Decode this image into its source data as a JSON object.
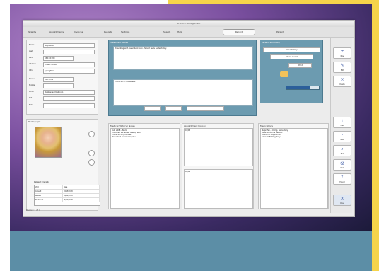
{
  "window": {
    "title": "Practice Management"
  },
  "toolbar": {
    "items": [
      "Patients",
      "Appointments",
      "Invoices",
      "Reports",
      "Settings",
      "Search",
      "Help"
    ],
    "segment_label": "Record",
    "right_label": "Patient"
  },
  "patient": {
    "fields": [
      {
        "label": "Name",
        "value": "Stephanie"
      },
      {
        "label": "Last",
        "value": ""
      },
      {
        "label": "Birth",
        "value": "03/15/1980"
      },
      {
        "label": "Address",
        "value": "4 Main Street"
      },
      {
        "label": "City",
        "value": "Springfield"
      },
      {
        "label": "Phone",
        "value": "555-1234"
      },
      {
        "label": "Mobile",
        "value": ""
      },
      {
        "label": "Email",
        "value": "stephanie@mail.com"
      },
      {
        "label": "Ref",
        "value": ""
      },
      {
        "label": "Note",
        "value": ""
      }
    ],
    "photo_label": "Photograph",
    "details_label": "Patient Details"
  },
  "notes": {
    "title": "Treatment Notes",
    "line1": "Presenting with lower back pain. Patient feels better today.",
    "line2": "Follow up in two weeks."
  },
  "history": {
    "title": "Medical History / Notes",
    "lines": [
      "Feb, 2008 - Neck",
      "Fractured vertebrae healing well",
      "Follow up on progress",
      "Prescribed exercise regime"
    ]
  },
  "appointments": {
    "title": "Appointment history",
    "lines": [
      "03/15",
      "04/12"
    ]
  },
  "medications": {
    "title": "Medications",
    "lines": [
      "Ibuprofen, 400mg, twice daily",
      "Paracetamol as needed",
      "Vitamin D supplement",
      "Calcium 500mg daily"
    ]
  },
  "summary": {
    "title": "Patient Summary",
    "btn1": "View history",
    "btn2": "Open record",
    "btn3": "Print",
    "progress": 0.72
  },
  "sidebar": {
    "items": [
      "New",
      "Edit",
      "Delete",
      "Prev",
      "Next",
      "Find",
      "Print",
      "Export",
      "Close"
    ]
  },
  "table": {
    "rows": [
      [
        "Visit",
        "Date"
      ],
      [
        "Consult",
        "03/15/2008"
      ],
      [
        "Review",
        "04/12/2008"
      ],
      [
        "Treatment",
        "05/02/2008"
      ]
    ]
  },
  "status": {
    "text": "Record 1 of 1"
  },
  "colors": {
    "accent": "#6c9bb0",
    "desktop": "#7a4f9f",
    "frame": "#5c8ea6",
    "border": "#f6d44a"
  }
}
